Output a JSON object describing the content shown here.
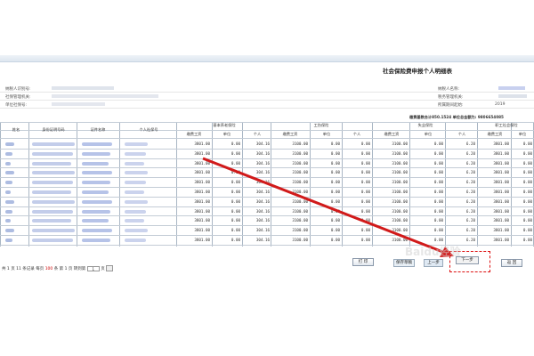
{
  "page": {
    "title": "社会保险费申报个人明细表"
  },
  "info": {
    "row1_left": "纳税人识别号:",
    "row1_right": "纳税人名称:",
    "row2_left": "社保管理机关:",
    "row2_right": "税务管理机关:",
    "row3_left": "单位社保号:",
    "row3_right": "所属期间起始:",
    "row3_right_value": "2019"
  },
  "summary": {
    "line": "缴费基数合计850.1524 单位总金额为: 9806654085"
  },
  "table": {
    "headers": [
      "姓名",
      "身份证明号码",
      "证件名称",
      "个人社保号"
    ],
    "groups": [
      "基本养老保险",
      "工伤保险",
      "失业保险",
      "职工社会保险"
    ],
    "sub_headers": {
      "g1": [
        "缴费工资",
        "单位",
        "个人"
      ],
      "g2": [
        "缴费工资",
        "单位",
        "个人"
      ],
      "g3": [
        "缴费工资",
        "单位",
        "个人"
      ],
      "g4": [
        "缴费工资",
        "单位"
      ]
    },
    "rows": [
      [
        "3801.00",
        "0.00",
        "304.16",
        "3100.00",
        "0.00",
        "0.00",
        "3100.00",
        "0.00",
        "6.20",
        "3801.00",
        "0.00"
      ],
      [
        "3801.00",
        "0.00",
        "304.16",
        "3100.00",
        "0.00",
        "0.00",
        "3100.00",
        "0.00",
        "6.20",
        "3801.00",
        "0.00"
      ],
      [
        "3801.00",
        "0.00",
        "304.16",
        "3100.00",
        "0.00",
        "0.00",
        "3100.00",
        "0.00",
        "6.20",
        "3801.00",
        "0.00"
      ],
      [
        "3801.00",
        "0.00",
        "304.16",
        "3100.00",
        "0.00",
        "0.00",
        "3100.00",
        "0.00",
        "6.20",
        "3801.00",
        "0.00"
      ],
      [
        "3801.00",
        "0.00",
        "304.16",
        "3100.00",
        "0.00",
        "0.00",
        "3100.00",
        "0.00",
        "6.20",
        "3801.00",
        "0.00"
      ],
      [
        "3801.00",
        "0.00",
        "304.16",
        "3100.00",
        "0.00",
        "0.00",
        "3100.00",
        "0.00",
        "6.20",
        "3801.00",
        "0.00"
      ],
      [
        "3801.00",
        "0.00",
        "304.16",
        "3100.00",
        "0.00",
        "0.00",
        "3100.00",
        "0.00",
        "6.20",
        "3801.00",
        "0.00"
      ],
      [
        "3801.00",
        "0.00",
        "304.16",
        "3100.00",
        "0.00",
        "0.00",
        "3100.00",
        "0.00",
        "6.20",
        "3801.00",
        "0.00"
      ],
      [
        "3801.00",
        "0.00",
        "304.16",
        "3100.00",
        "0.00",
        "0.00",
        "3100.00",
        "0.00",
        "6.20",
        "3801.00",
        "0.00"
      ],
      [
        "3801.00",
        "0.00",
        "304.16",
        "3100.00",
        "0.00",
        "0.00",
        "3100.00",
        "0.00",
        "6.20",
        "3801.00",
        "0.00"
      ],
      [
        "3801.00",
        "0.00",
        "304.16",
        "3100.00",
        "0.00",
        "0.00",
        "3100.00",
        "0.00",
        "6.20",
        "3801.00",
        "0.00"
      ]
    ]
  },
  "pager": {
    "text_1": "共 1 页 11 条记录 每页",
    "per_page": "100",
    "text_2": "条 第 1 页 转到第",
    "page_input": "1",
    "text_3": "页"
  },
  "buttons": {
    "print": "打 印",
    "save_draft": "保存草稿",
    "prev": "上一步",
    "next": "下一步",
    "back": "返 回"
  },
  "annotation": {
    "arrow_color": "#d11a1a"
  },
  "watermark": {
    "text": "Baidu经验"
  }
}
